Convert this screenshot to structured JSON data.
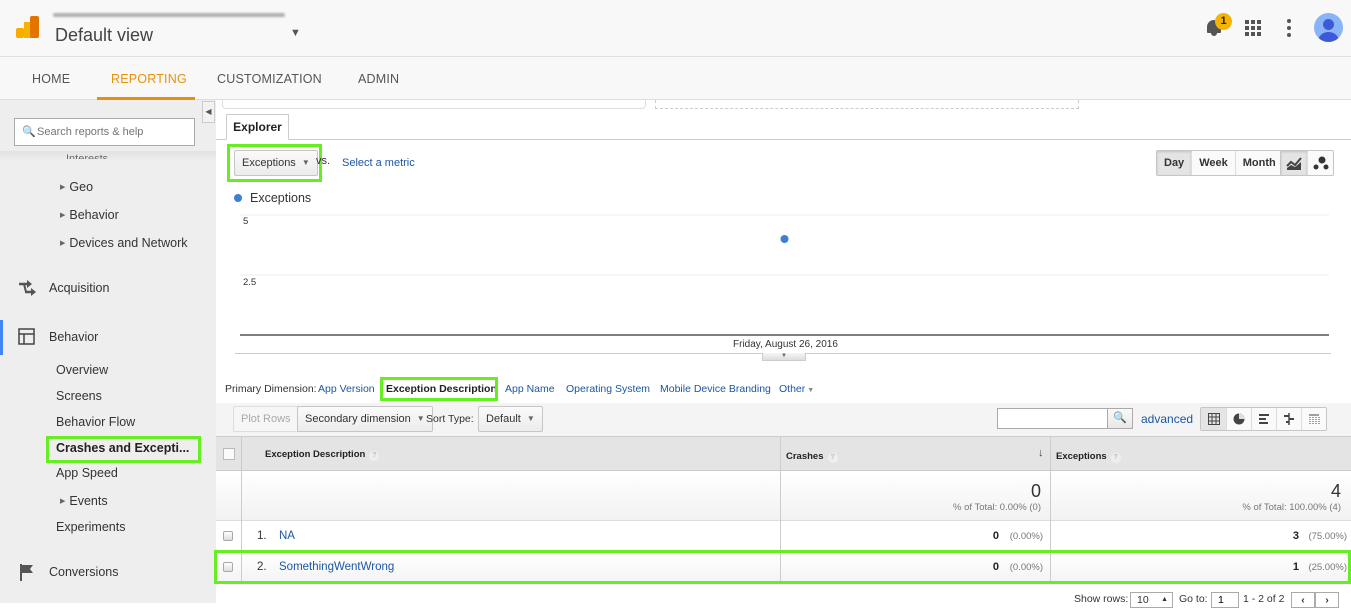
{
  "header": {
    "view_name": "Default view",
    "notification_count": "1"
  },
  "nav": {
    "items": [
      {
        "label": "HOME",
        "active": false
      },
      {
        "label": "REPORTING",
        "active": true
      },
      {
        "label": "CUSTOMIZATION",
        "active": false
      },
      {
        "label": "ADMIN",
        "active": false
      }
    ]
  },
  "sidebar": {
    "search_placeholder": "Search reports & help",
    "cut_label": "Interests",
    "audience_sub": [
      "Geo",
      "Behavior",
      "Devices and Network"
    ],
    "acquisition": "Acquisition",
    "behavior": "Behavior",
    "behavior_items": [
      "Overview",
      "Screens",
      "Behavior Flow",
      "Crashes and Excepti...",
      "App Speed",
      "Events",
      "Experiments"
    ],
    "conversions": "Conversions"
  },
  "explorer": {
    "tab_label": "Explorer",
    "metric_selected": "Exceptions",
    "vs_label": "vs.",
    "select_metric": "Select a metric",
    "granularity": [
      "Day",
      "Week",
      "Month"
    ],
    "granularity_active": "Day"
  },
  "chart_data": {
    "type": "scatter",
    "series": [
      {
        "name": "Exceptions",
        "color": "#3d7fd0",
        "x": [
          "Friday, August 26, 2016"
        ],
        "values": [
          4
        ]
      }
    ],
    "y_ticks": [
      "5",
      "2.5"
    ],
    "ylim": [
      0,
      5
    ],
    "x_tick_labels": [
      "Friday, August 26, 2016"
    ],
    "legend": "top-left",
    "grid": true
  },
  "primary_dimension": {
    "label": "Primary Dimension:",
    "options": [
      "App Version",
      "Exception Description",
      "App Name",
      "Operating System",
      "Mobile Device Branding",
      "Other"
    ],
    "active": "Exception Description"
  },
  "toolbar": {
    "plot_rows": "Plot Rows",
    "secondary_dimension": "Secondary dimension",
    "sort_type_label": "Sort Type:",
    "sort_type_value": "Default",
    "search_value": "",
    "advanced": "advanced"
  },
  "table": {
    "columns": [
      "Exception Description",
      "Crashes",
      "Exceptions"
    ],
    "totals": {
      "crashes": "0",
      "crashes_pct": "% of Total: 0.00% (0)",
      "exceptions": "4",
      "exceptions_pct": "% of Total: 100.00% (4)"
    },
    "rows": [
      {
        "index": "1.",
        "description": "NA",
        "crashes": "0",
        "crashes_pct": "(0.00%)",
        "exceptions": "3",
        "exceptions_pct": "(75.00%)"
      },
      {
        "index": "2.",
        "description": "SomethingWentWrong",
        "crashes": "0",
        "crashes_pct": "(0.00%)",
        "exceptions": "1",
        "exceptions_pct": "(25.00%)"
      }
    ]
  },
  "pager": {
    "show_rows_label": "Show rows:",
    "show_rows_value": "10",
    "goto_label": "Go to:",
    "goto_value": "1",
    "range": "1 - 2 of 2"
  }
}
